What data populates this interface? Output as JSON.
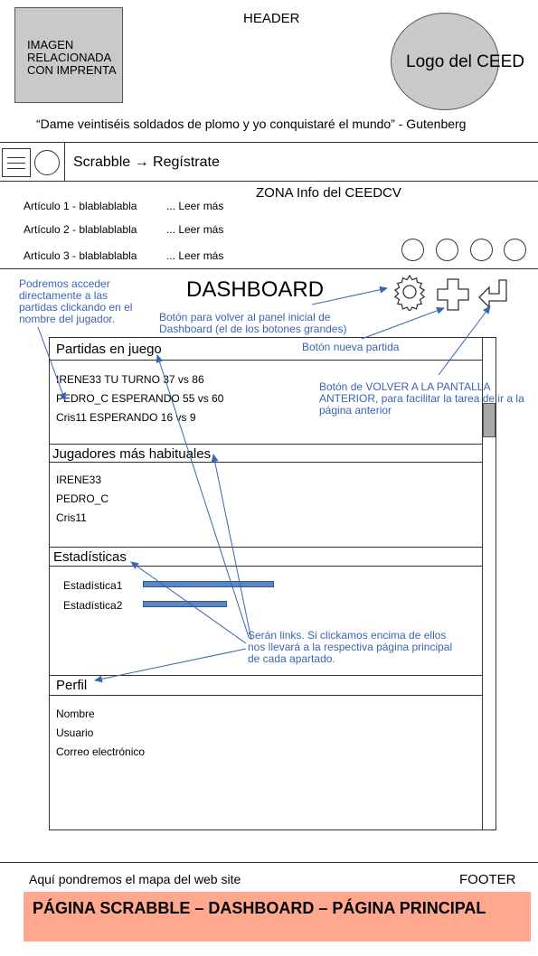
{
  "header": {
    "image_placeholder": "IMAGEN\nRELACIONADA\nCON IMPRENTA",
    "title": "HEADER",
    "logo": "Logo del CEED",
    "quote": "“Dame veintiséis soldados de plomo y yo conquistaré el mundo”  - Gutenberg"
  },
  "nav": {
    "breadcrumb": "Scrabble → Regístrate"
  },
  "info_zone": {
    "title": "ZONA Info del CEEDCV",
    "articles": [
      {
        "title": "Artículo 1 - blablablabla",
        "more": "... Leer más"
      },
      {
        "title": "Artículo 2 - blablablabla",
        "more": "... Leer más"
      },
      {
        "title": "Artículo 3 - blablablabla",
        "more": "... Leer más"
      }
    ]
  },
  "dashboard": {
    "title": "DASHBOARD",
    "notes": {
      "players_link": "Podremos acceder\ndirectamente a las\npartidas clickando en el\nnombre del jugador.",
      "home_button": "Botón para volver al panel inicial de\nDashboard (el de los botones grandes)",
      "new_game": "Botón nueva partida",
      "back_button": "Botón de VOLVER A LA PANTALLA\nANTERIOR, para facilitar la tarea de ir a la\npágina anterior",
      "links": "Serán links. Si clickamos encima de ellos\nnos llevará a la respectiva página principal\nde cada apartado."
    },
    "sections": {
      "games": {
        "title": "Partidas en juego",
        "rows": [
          "IRENE33  TU TURNO   37 vs 86",
          "PEDRO_C    ESPERANDO     55 vs 60",
          "Cris11     ESPERANDO     16 vs 9"
        ]
      },
      "players": {
        "title": "Jugadores más habituales",
        "rows": [
          "IRENE33",
          "PEDRO_C",
          "Cris11"
        ]
      },
      "stats": {
        "title": "Estadísticas",
        "rows": [
          "Estadística1",
          "Estadística2"
        ]
      },
      "profile": {
        "title": "Perfil",
        "rows": [
          "Nombre",
          "Usuario",
          "Correo electrónico"
        ]
      }
    }
  },
  "footer": {
    "map_text": "Aquí pondremos el mapa del web site",
    "label": "FOOTER",
    "banner": "PÁGINA SCRABBLE – DASHBOARD – PÁGINA PRINCIPAL"
  },
  "colors": {
    "annotation": "#3a64b6",
    "banner": "#ffa88f",
    "bar": "#5b86c0"
  }
}
